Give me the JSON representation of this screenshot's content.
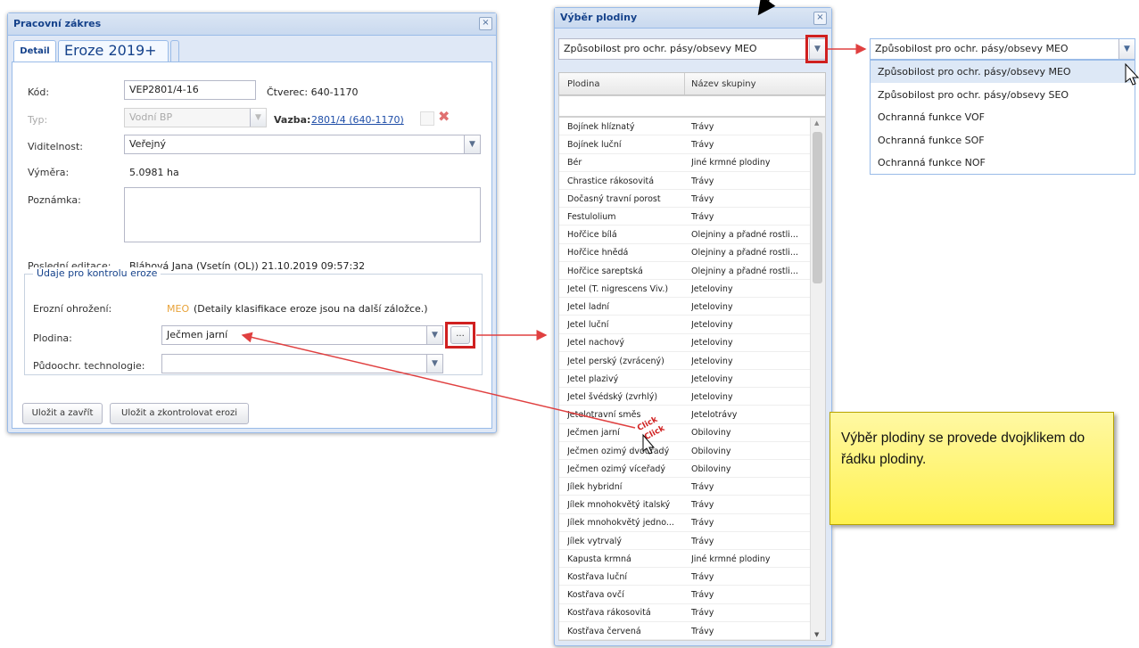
{
  "main_dialog": {
    "title": "Pracovní zákres",
    "close": "×",
    "tabs": [
      "Detail",
      "Eroze 2019+"
    ],
    "kod_label": "Kód:",
    "kod_value": "VEP2801/4-16",
    "ctverec": "Čtverec: 640-1170",
    "typ_label": "Typ:",
    "typ_value": "Vodní BP",
    "vazba_label": "Vazba:",
    "vazba_link": "2801/4 (640-1170)",
    "viditelnost_label": "Viditelnost:",
    "viditelnost_value": "Veřejný",
    "vymera_label": "Výměra:",
    "vymera_value": "5.0981 ha",
    "poznamka_label": "Poznámka:",
    "posledni_label": "Poslední editace:",
    "posledni_value": "Bláhová Jana (Vsetín (OL)) 21.10.2019 09:57:32",
    "fieldset_legend": "Údaje pro kontrolu eroze",
    "erozni_label": "Erozní ohrožení:",
    "erozni_code": "MEO",
    "erozni_text": "(Detaily klasifikace eroze jsou na další záložce.)",
    "plodina_label": "Plodina:",
    "plodina_value": "Ječmen jarní",
    "browse_button": "...",
    "pudo_label": "Půdoochr. technologie:",
    "btn_save_close": "Uložit a zavřít",
    "btn_save_check": "Uložit a zkontrolovat erozi"
  },
  "crop_dialog": {
    "title": "Výběr plodiny",
    "close": "×",
    "combo_value": "Způsobilost pro ochr. pásy/obsevy MEO",
    "col_plodina": "Plodina",
    "col_skupina": "Název skupiny",
    "rows": [
      [
        "Bojínek hlíznatý",
        "Trávy"
      ],
      [
        "Bojínek luční",
        "Trávy"
      ],
      [
        "Bér",
        "Jiné krmné plodiny"
      ],
      [
        "Chrastice rákosovitá",
        "Trávy"
      ],
      [
        "Dočasný travní porost",
        "Trávy"
      ],
      [
        "Festulolium",
        "Trávy"
      ],
      [
        "Hořčice bílá",
        "Olejniny a přadné rostli..."
      ],
      [
        "Hořčice hnědá",
        "Olejniny a přadné rostli..."
      ],
      [
        "Hořčice sareptská",
        "Olejniny a přadné rostli..."
      ],
      [
        "Jetel (T. nigrescens Viv.)",
        "Jeteloviny"
      ],
      [
        "Jetel ladní",
        "Jeteloviny"
      ],
      [
        "Jetel luční",
        "Jeteloviny"
      ],
      [
        "Jetel nachový",
        "Jeteloviny"
      ],
      [
        "Jetel perský (zvrácený)",
        "Jeteloviny"
      ],
      [
        "Jetel plazivý",
        "Jeteloviny"
      ],
      [
        "Jetel švédský (zvrhlý)",
        "Jeteloviny"
      ],
      [
        "Jetelotravní směs",
        "Jetelotrávy"
      ],
      [
        "Ječmen jarní",
        "Obiloviny"
      ],
      [
        "Ječmen ozimý dvouřadý",
        "Obiloviny"
      ],
      [
        "Ječmen ozimý víceřadý",
        "Obiloviny"
      ],
      [
        "Jílek hybridní",
        "Trávy"
      ],
      [
        "Jílek mnohokvětý italský",
        "Trávy"
      ],
      [
        "Jílek mnohokvětý jedno...",
        "Trávy"
      ],
      [
        "Jílek vytrvalý",
        "Trávy"
      ],
      [
        "Kapusta krmná",
        "Jiné krmné plodiny"
      ],
      [
        "Kostřava luční",
        "Trávy"
      ],
      [
        "Kostřava ovčí",
        "Trávy"
      ],
      [
        "Kostřava rákosovitá",
        "Trávy"
      ],
      [
        "Kostřava červená",
        "Trávy"
      ]
    ],
    "click_label": "Click"
  },
  "dropdown": {
    "value": "Způsobilost pro ochr. pásy/obsevy MEO",
    "options": [
      "Způsobilost pro ochr. pásy/obsevy MEO",
      "Způsobilost pro ochr. pásy/obsevy SEO",
      "Ochranná funkce VOF",
      "Ochranná funkce SOF",
      "Ochranná funkce NOF"
    ]
  },
  "note": {
    "text": "Výběr plodiny se provede dvojklikem do řádku plodiny."
  },
  "colors": {
    "highlight": "#d02020",
    "arrow": "#e04040",
    "accent": "#15428b",
    "meo": "#e8a33a",
    "note": "#fff24f"
  },
  "icons": [
    "close-icon",
    "dropdown-arrow-icon",
    "delete-icon",
    "mouse-cursor-icon",
    "scroll-up-icon",
    "scroll-down-icon"
  ]
}
